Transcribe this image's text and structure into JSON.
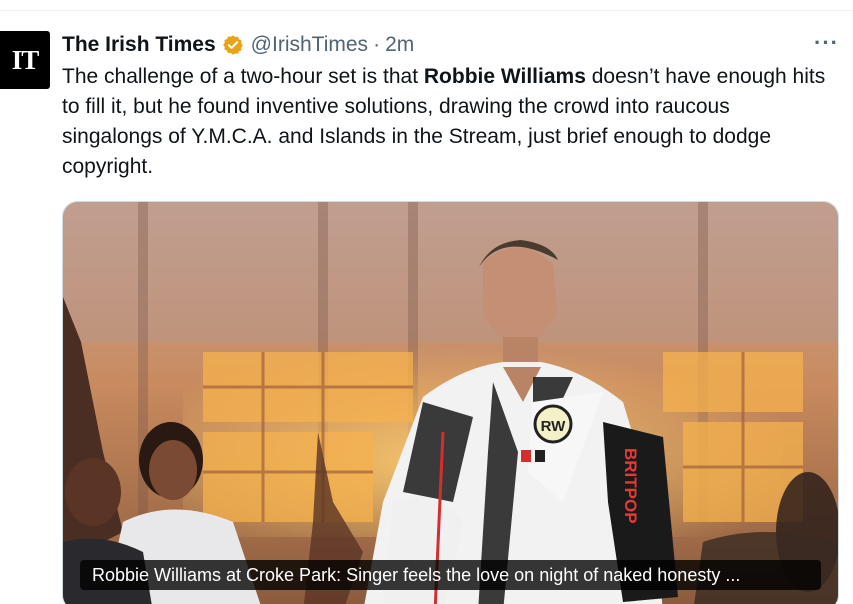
{
  "account": {
    "avatar_text": "IT",
    "display_name": "The Irish Times",
    "handle": "@IrishTimes",
    "separator": "·",
    "timestamp": "2m",
    "verified_icon": "verified-badge-gold",
    "verified_color": "#e8a317"
  },
  "menu": {
    "more_label": "···"
  },
  "tweet": {
    "text_before": "The challenge of a two-hour set is that ",
    "text_bold": "Robbie Williams",
    "text_after": " doesn’t have enough hits to fill it, but he found inventive solutions, drawing the crowd into raucous singalongs of Y.M.C.A. and Islands in the Stream, just brief enough to dodge copyright."
  },
  "card": {
    "image_subject": "Robbie Williams performing on stage in white jacket",
    "jacket_badge": "RW",
    "jacket_sleeve_text": "BRITPOP",
    "title": "Robbie Williams at Croke Park: Singer feels the love on night of naked honesty ..."
  }
}
